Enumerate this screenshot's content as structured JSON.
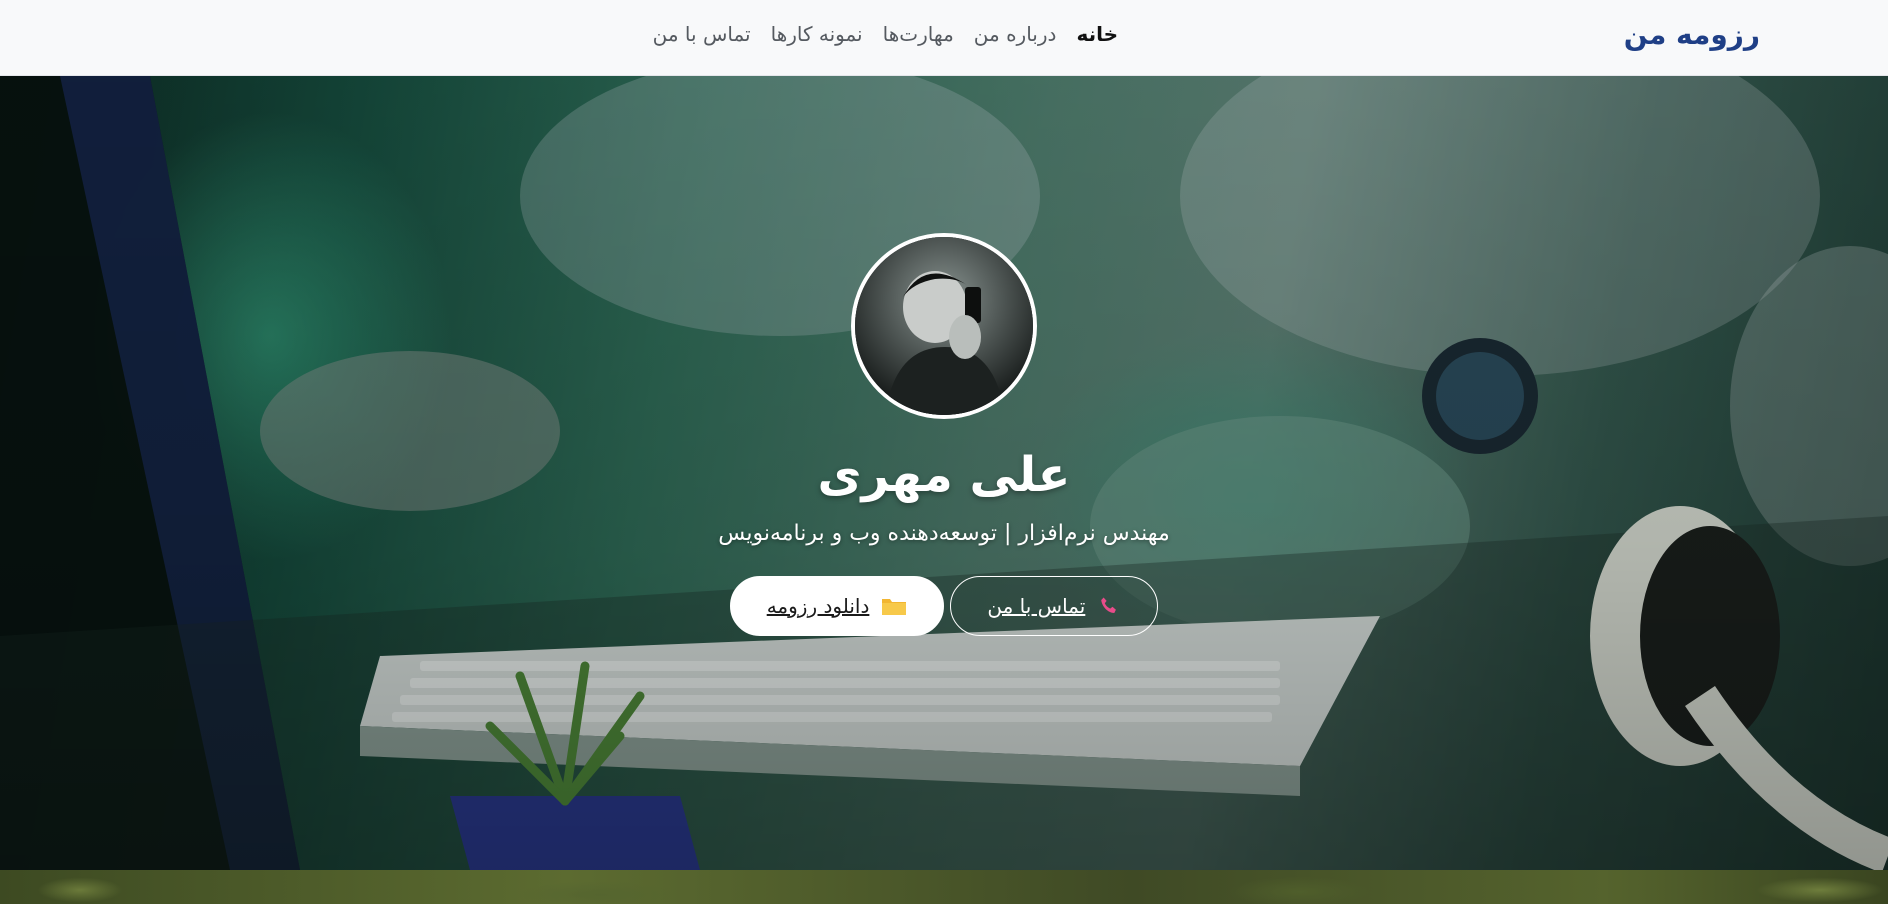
{
  "navbar": {
    "brand": "رزومه من",
    "links": [
      {
        "label": "خانه",
        "active": true
      },
      {
        "label": "درباره من",
        "active": false
      },
      {
        "label": "مهارت‌ها",
        "active": false
      },
      {
        "label": "نمونه کارها",
        "active": false
      },
      {
        "label": "تماس با من",
        "active": false
      }
    ]
  },
  "hero": {
    "name": "علی مهری",
    "subtitle": "مهندس نرم‌افزار | توسعه‌دهنده وب و برنامه‌نویس",
    "buttons": {
      "contact": {
        "label": "تماس با من",
        "icon": "phone-icon",
        "icon_color": "#e84c8a"
      },
      "download": {
        "label": "دانلود رزومه",
        "icon": "folder-icon",
        "icon_color": "#f2b632"
      }
    }
  },
  "colors": {
    "brand": "#1f3f86",
    "nav_text": "#555a60",
    "nav_active": "#111111"
  }
}
